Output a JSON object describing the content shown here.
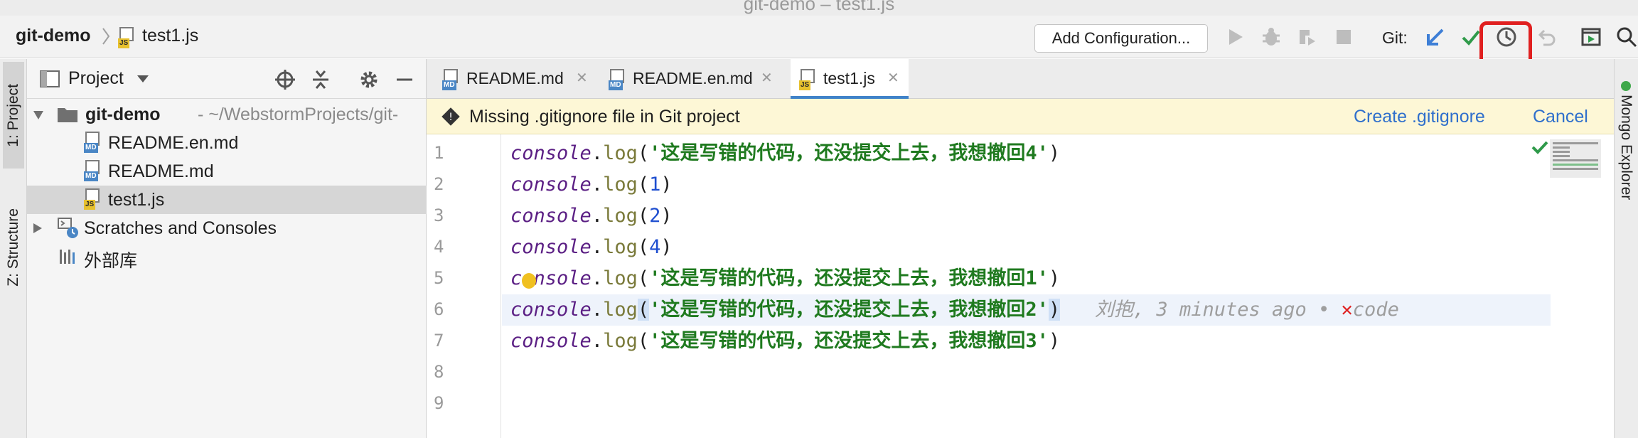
{
  "window": {
    "title": "git-demo – test1.js"
  },
  "breadcrumb": {
    "project": "git-demo",
    "file": "test1.js"
  },
  "toolbar": {
    "add_configuration": "Add Configuration...",
    "git_label": "Git:"
  },
  "left_stripe": {
    "project_tab": "1: Project",
    "structure_tab": "Z: Structure"
  },
  "project_panel": {
    "title": "Project",
    "tree": [
      {
        "name": "git-demo",
        "path": "- ~/WebstormProjects/git-"
      },
      {
        "name": "README.en.md"
      },
      {
        "name": "README.md"
      },
      {
        "name": "test1.js"
      },
      {
        "name": "Scratches and Consoles"
      },
      {
        "name": "外部库"
      }
    ]
  },
  "tabs": [
    {
      "label": "README.md",
      "icon": "md"
    },
    {
      "label": "README.en.md",
      "icon": "md"
    },
    {
      "label": "test1.js",
      "icon": "js",
      "active": true
    }
  ],
  "banner": {
    "message": "Missing .gitignore file in Git project",
    "create": "Create .gitignore",
    "cancel": "Cancel"
  },
  "editor": {
    "line_numbers": [
      "1",
      "2",
      "3",
      "4",
      "5",
      "6",
      "7",
      "8",
      "9"
    ],
    "lines": [
      {
        "obj": "console",
        "fn": "log",
        "arg": "'这是写错的代码，还没提交上去，我想撤回4'",
        "type": "string"
      },
      {
        "obj": "console",
        "fn": "log",
        "arg": "1",
        "type": "number"
      },
      {
        "obj": "console",
        "fn": "log",
        "arg": "2",
        "type": "number"
      },
      {
        "obj": "console",
        "fn": "log",
        "arg": "4",
        "type": "number"
      },
      {
        "obj": "console",
        "fn": "log",
        "arg": "'这是写错的代码，还没提交上去，我想撤回1'",
        "type": "string"
      },
      {
        "obj": "console",
        "fn": "log",
        "arg": "'这是写错的代码，还没提交上去，我想撤回2'",
        "type": "string"
      },
      {
        "obj": "console",
        "fn": "log",
        "arg": "'这是写错的代码，还没提交上去，我想撤回3'",
        "type": "string"
      }
    ],
    "blame": {
      "author": "刘抱, 3 minutes ago •",
      "commit": "code"
    }
  },
  "right_stripe": {
    "mongo": "Mongo Explorer"
  },
  "colors": {
    "highlight_box": "#e02020",
    "banner_bg": "#fdf7d6",
    "link": "#2f6fcc"
  }
}
